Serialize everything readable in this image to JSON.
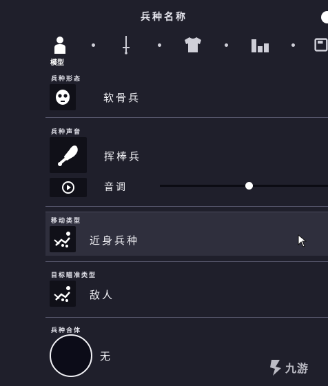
{
  "header": {
    "title": "兵种名称"
  },
  "tabs": [
    {
      "icon": "person-icon",
      "label": "模型",
      "active": true
    },
    {
      "icon": "sword-icon",
      "label": ""
    },
    {
      "icon": "shirt-icon",
      "label": ""
    },
    {
      "icon": "stats-icon",
      "label": ""
    },
    {
      "icon": "save-icon",
      "label": ""
    }
  ],
  "tab_active_label": "模型",
  "sections": {
    "form": {
      "label": "兵种形态",
      "value": "软骨兵",
      "icon": "skull-face-icon"
    },
    "voice": {
      "label": "兵种声音",
      "value": "挥棒兵",
      "icon": "drumstick-icon",
      "pitch_label": "音调",
      "pitch_level": 0.53
    },
    "movement": {
      "label": "移动类型",
      "value": "近身兵种",
      "icon": "melee-unit-icon"
    },
    "targeting": {
      "label": "目标瞄准类型",
      "value": "敌人",
      "icon": "target-unit-icon"
    },
    "combine": {
      "label": "兵种合体",
      "value": "无"
    }
  },
  "watermark": {
    "text": "九游"
  },
  "colors": {
    "background": "#1f1f2b",
    "highlight": "#2f2f3d",
    "divider": "#55556a",
    "text": "#ffffff"
  }
}
